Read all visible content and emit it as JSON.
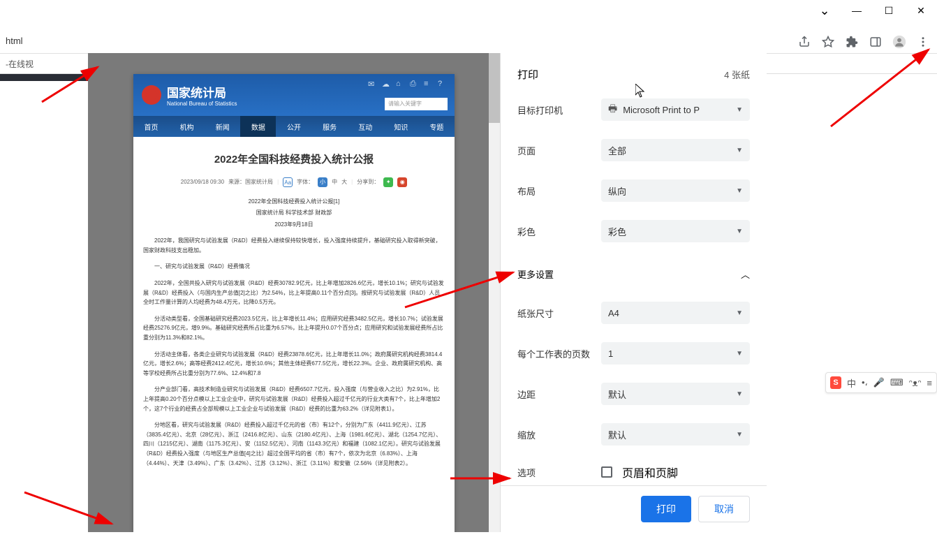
{
  "window_controls": {
    "chevron": "⌄",
    "min": "—",
    "max": "☐",
    "close": "✕"
  },
  "addr_text": "html",
  "addr_icons": {
    "share": "share-icon",
    "star": "star-icon",
    "ext": "puzzle-icon",
    "panel": "panel-icon",
    "profile": "profile-icon",
    "menu": "menu-icon"
  },
  "tab_text": "-在线视",
  "preview": {
    "site_name_cn": "国家统计局",
    "site_name_en": "National Bureau of Statistics",
    "search_placeholder": "请输入关键字",
    "nav": [
      "首页",
      "机构",
      "新闻",
      "数据",
      "公开",
      "服务",
      "互动",
      "知识",
      "专题"
    ],
    "nav_active_index": 3,
    "title": "2022年全国科技经费投入统计公报",
    "meta_date": "2023/09/18 09:30",
    "meta_source": "来源：国家统计局",
    "meta_font_label": "字体：",
    "meta_size_sm": "小",
    "meta_size_md": "中",
    "meta_size_lg": "大",
    "meta_share": "分享到：",
    "sub1": "2022年全国科技经费投入统计公报[1]",
    "sub2": "国家统计局 科学技术部 财政部",
    "sub3": "2023年9月18日",
    "paragraphs": [
      "2022年，我国研究与试验发展（R&D）经费投入继续保持较快增长，投入强度持续提升，基础研究投入取得新突破，国家财政科技支出稳加。",
      "一、研究与试验发展（R&D）经费情况",
      "2022年，全国共投入研究与试验发展（R&D）经费30782.9亿元，比上年增加2826.6亿元，增长10.1%；研究与试验发展（R&D）经费投入（与国内生产总值[2]之比）为2.54%，比上年提高0.11个百分点[3]。按研究与试验发展（R&D）人员全时工作量计算的人均经费为48.4万元，比降0.5万元。",
      "分活动类型看，全国基础研究经费2023.5亿元，比上年增长11.4%；应用研究经费3482.5亿元，增长10.7%；试验发展经费25276.9亿元，增9.9%。基础研究经费所占比重为6.57%，比上年提升0.07个百分点；应用研究和试验发展经费所占比重分别为11.3%和82.1%。",
      "分活动主体看，各类企业研究与试验发展（R&D）经费23878.6亿元，比上年增长11.0%；政府属研究机构经费3814.4亿元，增长2.6%；高等经费2412.4亿元，增长10.6%；其他主体经费677.5亿元，增长22.3%。企业、政府属研究机构、高等学校经费所占比重分别为77.6%、12.4%和7.8",
      "分产业部门看，高技术制造业研究与试验发展（R&D）经费6507.7亿元，投入强度（与营业收入之比）为2.91%，比上年提高0.20个百分点模以上工业企业中，研究与试验发展（R&D）经费投入超过千亿元的行业大类有7个，比上年增加2个，这7个行业的经费占全部规模以上工业企业与试验发展（R&D）经费的比重为63.2%（详见附表1）。",
      "分地区看，研究与试验发展（R&D）经费投入超过千亿元的省（市）有12个，分别为广东（4411.9亿元）、江苏（3835.4亿元）、北京（28亿元）、浙江（2416.8亿元）、山东（2180.4亿元）、上海（1981.6亿元）、湖北（1254.7亿元）、四川（1215亿元）、湖南（1175.3亿元）、安（1152.5亿元）、河南（1143.3亿元）和福建（1082.1亿元）。研究与试验发展（R&D）经费投入强度（与地区生产总值[4]之比）超过全国平均的省（市）有7个，依次为北京（6.83%）、上海（4.44%）、天津（3.49%）、广东（3.42%）、江苏（3.12%）、浙江（3.11%）和安徽（2.56%（详见附表2）。"
    ]
  },
  "print": {
    "header": "打印",
    "sheets": "4 张纸",
    "rows": {
      "dest_label": "目标打印机",
      "dest_value": "Microsoft Print to P",
      "pages_label": "页面",
      "pages_value": "全部",
      "layout_label": "布局",
      "layout_value": "纵向",
      "color_label": "彩色",
      "color_value": "彩色",
      "more": "更多设置",
      "paper_label": "纸张尺寸",
      "paper_value": "A4",
      "ppw_label": "每个工作表的页数",
      "ppw_value": "1",
      "margin_label": "边距",
      "margin_value": "默认",
      "scale_label": "缩放",
      "scale_value": "默认",
      "option_label": "选项",
      "option_check": "页眉和页脚"
    },
    "footer": {
      "ok": "打印",
      "cancel": "取消"
    }
  },
  "ime": {
    "cn": "中"
  }
}
